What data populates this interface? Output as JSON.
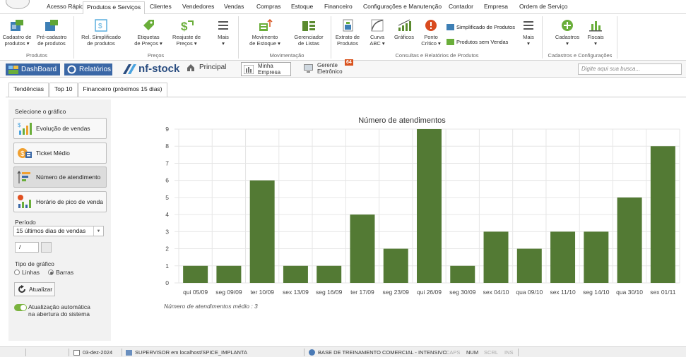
{
  "menubar": {
    "items": [
      "Acesso Rápido",
      "Produtos e Serviços",
      "Clientes",
      "Vendedores",
      "Vendas",
      "Compras",
      "Estoque",
      "Financeiro",
      "Configurações e Manutenção",
      "Contador",
      "Empresa",
      "Ordem de Serviço"
    ],
    "active": "Produtos e Serviços"
  },
  "ribbon": {
    "buttons": {
      "cadastro_produtos": [
        "Cadastro de",
        "produtos ▾"
      ],
      "pre_cadastro": [
        "Pré-cadastro",
        "de produtos"
      ],
      "rel_simplificado": [
        "Rel. Simplificado",
        "de produtos"
      ],
      "etiquetas": [
        "Etiquetas",
        "de Preços ▾"
      ],
      "reajuste": [
        "Reajuste de",
        "Preços ▾"
      ],
      "mais1": [
        "Mais",
        "▾"
      ],
      "movimento": [
        "Movimento",
        "de Estoque ▾"
      ],
      "gerenciador": [
        "Gerenciador",
        "de Listas"
      ],
      "extrato": [
        "Extrato de",
        "Produtos"
      ],
      "curva": [
        "Curva",
        "ABC ▾"
      ],
      "graficos": [
        "Gráficos",
        ""
      ],
      "ponto": [
        "Ponto",
        "Crítico ▾"
      ],
      "mais2": [
        "Mais",
        "▾"
      ],
      "cadastros": [
        "Cadastros",
        "▾"
      ],
      "fiscais": [
        "Fiscais",
        "▾"
      ]
    },
    "small": {
      "simplificado": "Simplificado de Produtos",
      "sem_vendas": "Produtos sem Vendas"
    },
    "groups": {
      "produtos": "Produtos",
      "precos": "Preços",
      "movimentacao": "Movimentação",
      "consultas": "Consultas e Relatórios de Produtos",
      "cadastros": "Cadastros e Configurações"
    }
  },
  "navbar": {
    "dashboard": "DashBoard",
    "relatorios": "Relatórios",
    "brand": "nf-stock",
    "principal": "Principal",
    "minha_empresa": [
      "Minha",
      "Empresa"
    ],
    "gerente": [
      "Gerente",
      "Eletrônico"
    ],
    "gerente_badge": "64",
    "search_placeholder": "Digite aqui sua busca..."
  },
  "subtabs": [
    "Tendências",
    "Top 10",
    "Financeiro (próximos 15 dias)"
  ],
  "sidebar": {
    "select_label": "Selecione o gráfico",
    "buttons": [
      "Evolução de vendas",
      "Ticket Médio",
      "Número de atendimento",
      "Horário de pico de venda"
    ],
    "periodo_label": "Período",
    "periodo_value": "15 últimos dias de vendas",
    "date_value": "/",
    "tipo_label": "Tipo de gráfico",
    "tipo_linhas": "Linhas",
    "tipo_barras": "Barras",
    "atualizar": "Atualizar",
    "auto_update": [
      "Atualização automática",
      "na abertura do sistema"
    ]
  },
  "chart_data": {
    "type": "bar",
    "title": "Número de atendimentos",
    "categories": [
      "qui 05/09",
      "seg 09/09",
      "ter 10/09",
      "sex 13/09",
      "seg 16/09",
      "ter 17/09",
      "seg 23/09",
      "qui 26/09",
      "seg 30/09",
      "sex 04/10",
      "qua 09/10",
      "sex 11/10",
      "seg 14/10",
      "qua 30/10",
      "sex 01/11"
    ],
    "values": [
      1,
      1,
      6,
      1,
      1,
      4,
      2,
      9,
      1,
      3,
      2,
      3,
      3,
      5,
      8
    ],
    "ylim": [
      0,
      9
    ],
    "yticks": [
      0,
      1,
      2,
      3,
      4,
      5,
      6,
      7,
      8,
      9
    ],
    "grid": true,
    "bar_color": "#537a34",
    "footnote": "Número de atendimentos médio : 3"
  },
  "statusbar": {
    "date": "03-dez-2024",
    "user": "SUPERVISOR em localhost/SPICE_IMPLANTA",
    "db": "BASE DE TREINAMENTO COMERCIAL - INTENSIVO",
    "caps": "CAPS",
    "num": "NUM",
    "scrl": "SCRL",
    "ins": "INS"
  }
}
